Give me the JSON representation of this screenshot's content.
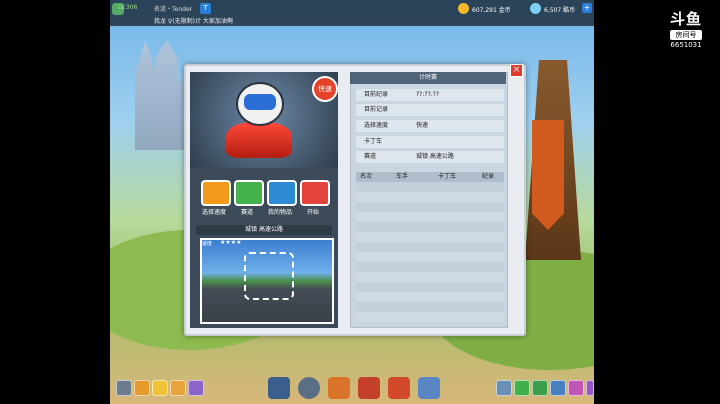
{
  "topbar": {
    "level": "LV.306",
    "player": "名流・Tender",
    "t_label": "T",
    "chat": "我龙 ♀(无限制)计 大家加油啊",
    "coins": "607,291 金币",
    "gems": "6,507 酷币",
    "plus": "+"
  },
  "watermark": {
    "logo": "斗鱼",
    "room_label": "房间号",
    "room_id": "6651031"
  },
  "dialog": {
    "close": "×",
    "quick_button": "快速",
    "buttons": [
      {
        "label": "选择速度",
        "color": "#f39a1a"
      },
      {
        "label": "赛道",
        "color": "#43b24a"
      },
      {
        "label": "我的物品",
        "color": "#2d8bd6"
      },
      {
        "label": "开始",
        "color": "#e3433a"
      }
    ],
    "track_header": "城镇 高速公路",
    "speed_tag": "速度",
    "stars": "★★★★",
    "panel_title": "计时赛",
    "fields": [
      {
        "label": "目前纪录",
        "value": "??:??.??"
      },
      {
        "label": "目前记录",
        "value": ""
      },
      {
        "label": "选择速度",
        "value": "快速"
      },
      {
        "label": "卡丁车",
        "value": ""
      },
      {
        "label": "赛道",
        "value": "城镇 高速公路"
      }
    ],
    "table_headers": [
      "名次",
      "车手",
      "卡丁车",
      "纪录"
    ]
  },
  "bottombar": {
    "left_icons": [
      "settings-icon",
      "home-icon",
      "chat-icon",
      "mail-icon",
      "help-icon"
    ],
    "center_icons": [
      "race-icon",
      "garage-icon",
      "shop-icon",
      "treasure-icon",
      "gift-icon",
      "club-icon"
    ],
    "right_icons": [
      "friends-icon",
      "guild-icon",
      "rank-icon",
      "event-icon",
      "message-icon",
      "system-icon"
    ]
  }
}
